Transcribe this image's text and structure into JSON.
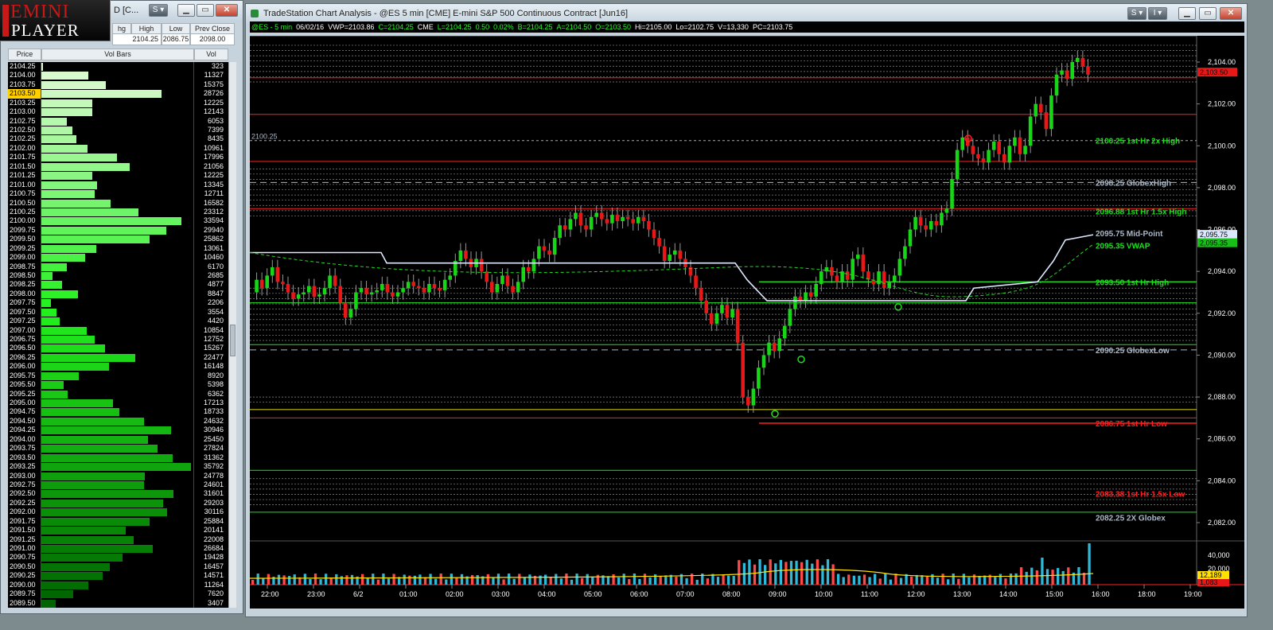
{
  "colors": {
    "bid": "#00ff00",
    "chart_bg": "#000000",
    "red_level": "#ff2020",
    "green_level": "#22dd22",
    "grey_level": "#aab7c6",
    "price_tag": "#ffd000"
  },
  "logo": {
    "line1": "EMINI",
    "line2": "PLAYER"
  },
  "left_window": {
    "title_fragment": "D [C...",
    "header_top": {
      "cols": [
        "hg",
        "High",
        "Low",
        "Prev Close"
      ],
      "values": [
        "",
        "2104.25",
        "2086.75",
        "2098.00"
      ]
    },
    "ladder_headers": [
      "Price",
      "Vol Bars",
      "Vol"
    ],
    "current_price": "2103.50",
    "rows": [
      [
        "2104.25",
        323
      ],
      [
        "2104.00",
        11327
      ],
      [
        "2103.75",
        15375
      ],
      [
        "2103.50",
        28726
      ],
      [
        "2103.25",
        12225
      ],
      [
        "2103.00",
        12143
      ],
      [
        "2102.75",
        6053
      ],
      [
        "2102.50",
        7399
      ],
      [
        "2102.25",
        8435
      ],
      [
        "2102.00",
        10961
      ],
      [
        "2101.75",
        17996
      ],
      [
        "2101.50",
        21056
      ],
      [
        "2101.25",
        12225
      ],
      [
        "2101.00",
        13345
      ],
      [
        "2100.75",
        12711
      ],
      [
        "2100.50",
        16582
      ],
      [
        "2100.25",
        23312
      ],
      [
        "2100.00",
        33594
      ],
      [
        "2099.75",
        29940
      ],
      [
        "2099.50",
        25862
      ],
      [
        "2099.25",
        13061
      ],
      [
        "2099.00",
        10460
      ],
      [
        "2098.75",
        6170
      ],
      [
        "2098.50",
        2685
      ],
      [
        "2098.25",
        4877
      ],
      [
        "2098.00",
        8847
      ],
      [
        "2097.75",
        2206
      ],
      [
        "2097.50",
        3554
      ],
      [
        "2097.25",
        4420
      ],
      [
        "2097.00",
        10854
      ],
      [
        "2096.75",
        12752
      ],
      [
        "2096.50",
        15267
      ],
      [
        "2096.25",
        22477
      ],
      [
        "2096.00",
        16148
      ],
      [
        "2095.75",
        8920
      ],
      [
        "2095.50",
        5398
      ],
      [
        "2095.25",
        6362
      ],
      [
        "2095.00",
        17213
      ],
      [
        "2094.75",
        18733
      ],
      [
        "2094.50",
        24632
      ],
      [
        "2094.25",
        30946
      ],
      [
        "2094.00",
        25450
      ],
      [
        "2093.75",
        27824
      ],
      [
        "2093.50",
        31362
      ],
      [
        "2093.25",
        35792
      ],
      [
        "2093.00",
        24778
      ],
      [
        "2092.75",
        24601
      ],
      [
        "2092.50",
        31601
      ],
      [
        "2092.25",
        29203
      ],
      [
        "2092.00",
        30116
      ],
      [
        "2091.75",
        25884
      ],
      [
        "2091.50",
        20141
      ],
      [
        "2091.25",
        22008
      ],
      [
        "2091.00",
        26684
      ],
      [
        "2090.75",
        19428
      ],
      [
        "2090.50",
        16457
      ],
      [
        "2090.25",
        14571
      ],
      [
        "2090.00",
        11264
      ],
      [
        "2089.75",
        7620
      ],
      [
        "2089.50",
        3407
      ]
    ]
  },
  "chart_window": {
    "title": "TradeStation Chart Analysis - @ES 5 min [CME] E-mini S&P 500 Continuous Contract [Jun16]",
    "quote_line": [
      "@ES - 5 min",
      "06/02/16",
      "VWP=2103.86",
      "C=2104.25",
      "CME",
      "L=2104.25",
      "0.50",
      "0.02%",
      "B=2104.25",
      "A=2104.50",
      "O=2103.50",
      "Hi=2105.00",
      "Lo=2102.75",
      "V=13,330",
      "PC=2103.75"
    ],
    "price_labels": [
      "2,104.00",
      "2,102.00",
      "2,100.00",
      "2,098.00",
      "2,096.00",
      "2,094.00",
      "2,092.00",
      "2,090.00",
      "2,088.00",
      "2,086.00",
      "2,084.00",
      "2,082.00"
    ],
    "current_tag": "2,103.50",
    "mid_tag": "2,095.75",
    "vwap_tag": "2,095.35",
    "vol_labels": [
      "40,000",
      "20,000"
    ],
    "vol_tags": [
      "12,189",
      "1,083"
    ],
    "time_labels": [
      "22:00",
      "23:00",
      "6/2",
      "01:00",
      "02:00",
      "03:00",
      "04:00",
      "05:00",
      "06:00",
      "07:00",
      "08:00",
      "09:00",
      "10:00",
      "11:00",
      "12:00",
      "13:00",
      "14:00",
      "15:00",
      "16:00",
      "18:00",
      "19:00"
    ],
    "left_level_label": "2100.25",
    "levels": [
      {
        "text": "2100.25 1st Hr  2x High",
        "color": "#22dd22"
      },
      {
        "text": "2098.25 GlobexHigh",
        "color": "#aab7c6"
      },
      {
        "text": "2096.88 1st Hr  1.5x High",
        "color": "#22dd22"
      },
      {
        "text": "2095.75 Mid-Point",
        "color": "#aab7c6"
      },
      {
        "text": "2095.35 VWAP",
        "color": "#22dd22"
      },
      {
        "text": "2093.50 1st Hr  High",
        "color": "#22dd22"
      },
      {
        "text": "2090.25 GlobexLow",
        "color": "#aab7c6"
      },
      {
        "text": "2086.75 1st Hr  Low",
        "color": "#ff2020"
      },
      {
        "text": "2083.38 1st Hr  1.5x Low",
        "color": "#ff2020"
      },
      {
        "text": "2082.25 2X Globex",
        "color": "#aab7c6"
      }
    ]
  }
}
